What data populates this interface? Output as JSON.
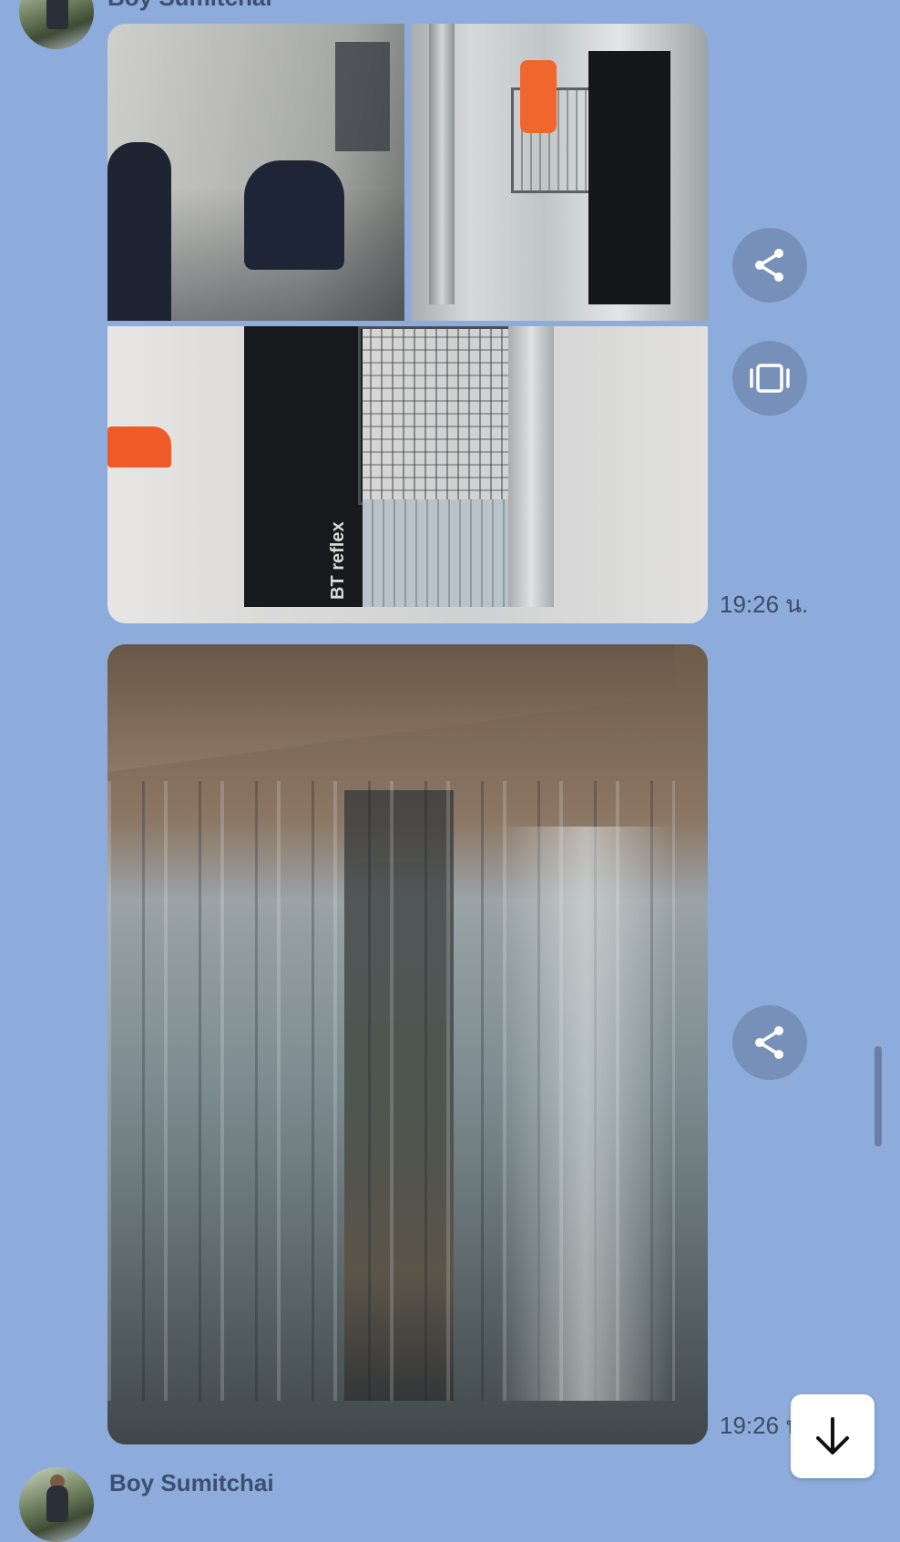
{
  "chat": {
    "top_sender": "Boy Sumitchai",
    "messages": [
      {
        "time": "19:26 น."
      },
      {
        "time": "19:26 น."
      }
    ],
    "bottom_sender": "Boy Sumitchai"
  },
  "photos": {
    "photo3_label": "BT reflex"
  },
  "icons": {
    "share": "share-icon",
    "gallery": "gallery-icon",
    "scroll_down": "arrow-down-icon"
  },
  "colors": {
    "background": "#8eacdb",
    "button": "#7790ba"
  }
}
